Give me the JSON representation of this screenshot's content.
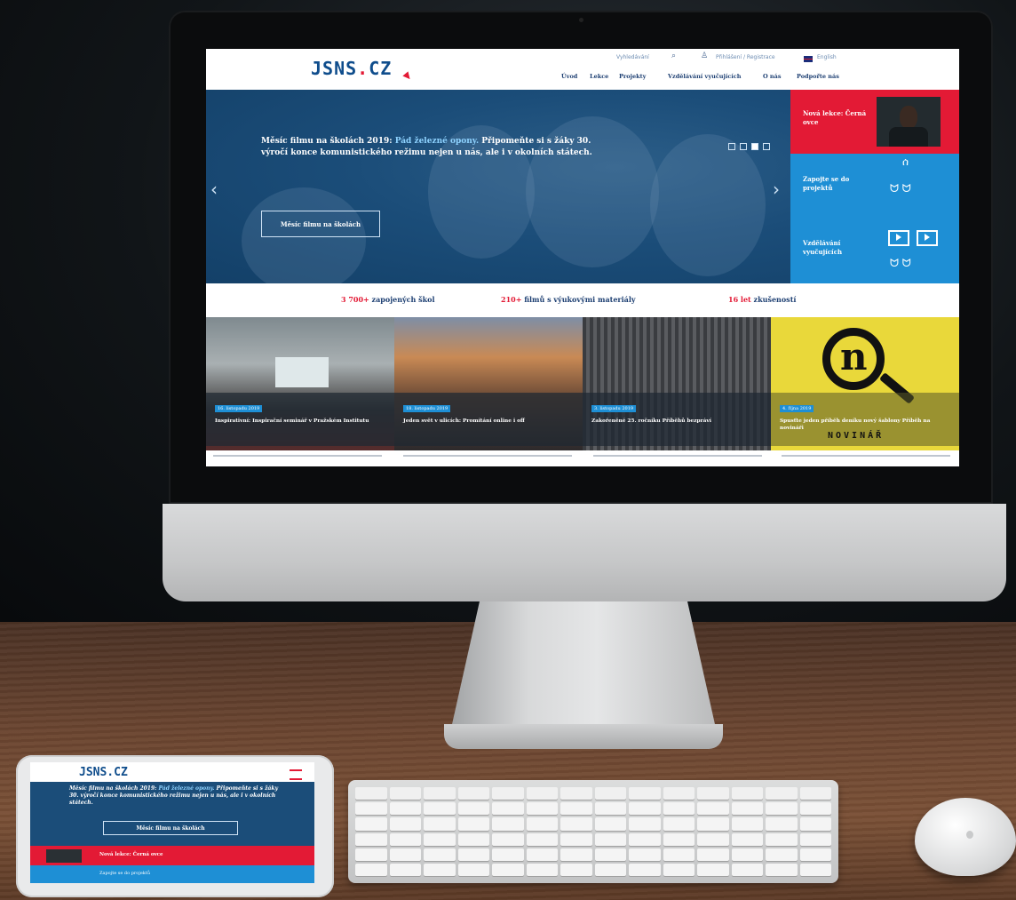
{
  "site": {
    "logo_main": "JSNS",
    "logo_dot": ".",
    "logo_tld": "CZ"
  },
  "util_bar": {
    "search_label": "Vyhledávání",
    "login_label": "Přihlášení / Registrace",
    "language_label": "English"
  },
  "nav": {
    "items": [
      "Úvod",
      "Lekce",
      "Projekty",
      "Vzdělávání vyučujících",
      "O nás",
      "Podpořte nás"
    ]
  },
  "hero": {
    "text_before": "Měsíc filmu na školách 2019: ",
    "text_highlight": "Pád železné opony.",
    "text_after": " Připomeňte si s žáky 30. výročí konce komunistického režimu nejen u nás, ale i v okolních státech.",
    "button_label": "Měsíc filmu na školách",
    "slider_dots": 4,
    "active_dot": 3
  },
  "sidebar": {
    "new_lesson_label": "Nová lekce: Černá ovce",
    "join_label": "Zapojte se do projektů",
    "training_label": "Vzdělávání vyučujících"
  },
  "stats": [
    {
      "num": "3 700+",
      "text": " zapojených škol"
    },
    {
      "num": "210+",
      "text": " filmů s výukovými materiály"
    },
    {
      "num": "16 let",
      "text": " zkušeností"
    }
  ],
  "tiles": [
    {
      "date": "16. listopadu 2019",
      "title": "Inspirativní: Inspirační seminář v Pražském Institutu"
    },
    {
      "date": "18. listopadu 2019",
      "title": "Jeden svět v ulicích: Promítání online i off"
    },
    {
      "date": "3. listopadu 2019",
      "title": "Zakořeněné 25. ročníku Příběhů bezpráví"
    },
    {
      "date": "4. října 2019",
      "title": "Spusťte jeden příběh deníku nový šablony Příběh na novináři",
      "brand": "NOVINÁŘ",
      "brand_letter": "n"
    }
  ],
  "tablet": {
    "logo": "JSNS.CZ",
    "text_before": "Měsíc filmu na školách 2019: ",
    "text_highlight": "Pád železné opony.",
    "text_after": " Připomeňte si s žáky 30. výročí konce komunistického režimu nejen u nás, ale i v okolních státech.",
    "button_label": "Měsíc filmu na školách",
    "new_lesson_label": "Nová lekce: Černá ovce",
    "blue_label": "Zapojte se do projektů"
  },
  "colors": {
    "brand_blue": "#0f4d8c",
    "accent_red": "#e31a35",
    "sky_blue": "#1e8fd5",
    "hero_blue": "#1b4d79",
    "novinar_yellow": "#e9d83a"
  }
}
